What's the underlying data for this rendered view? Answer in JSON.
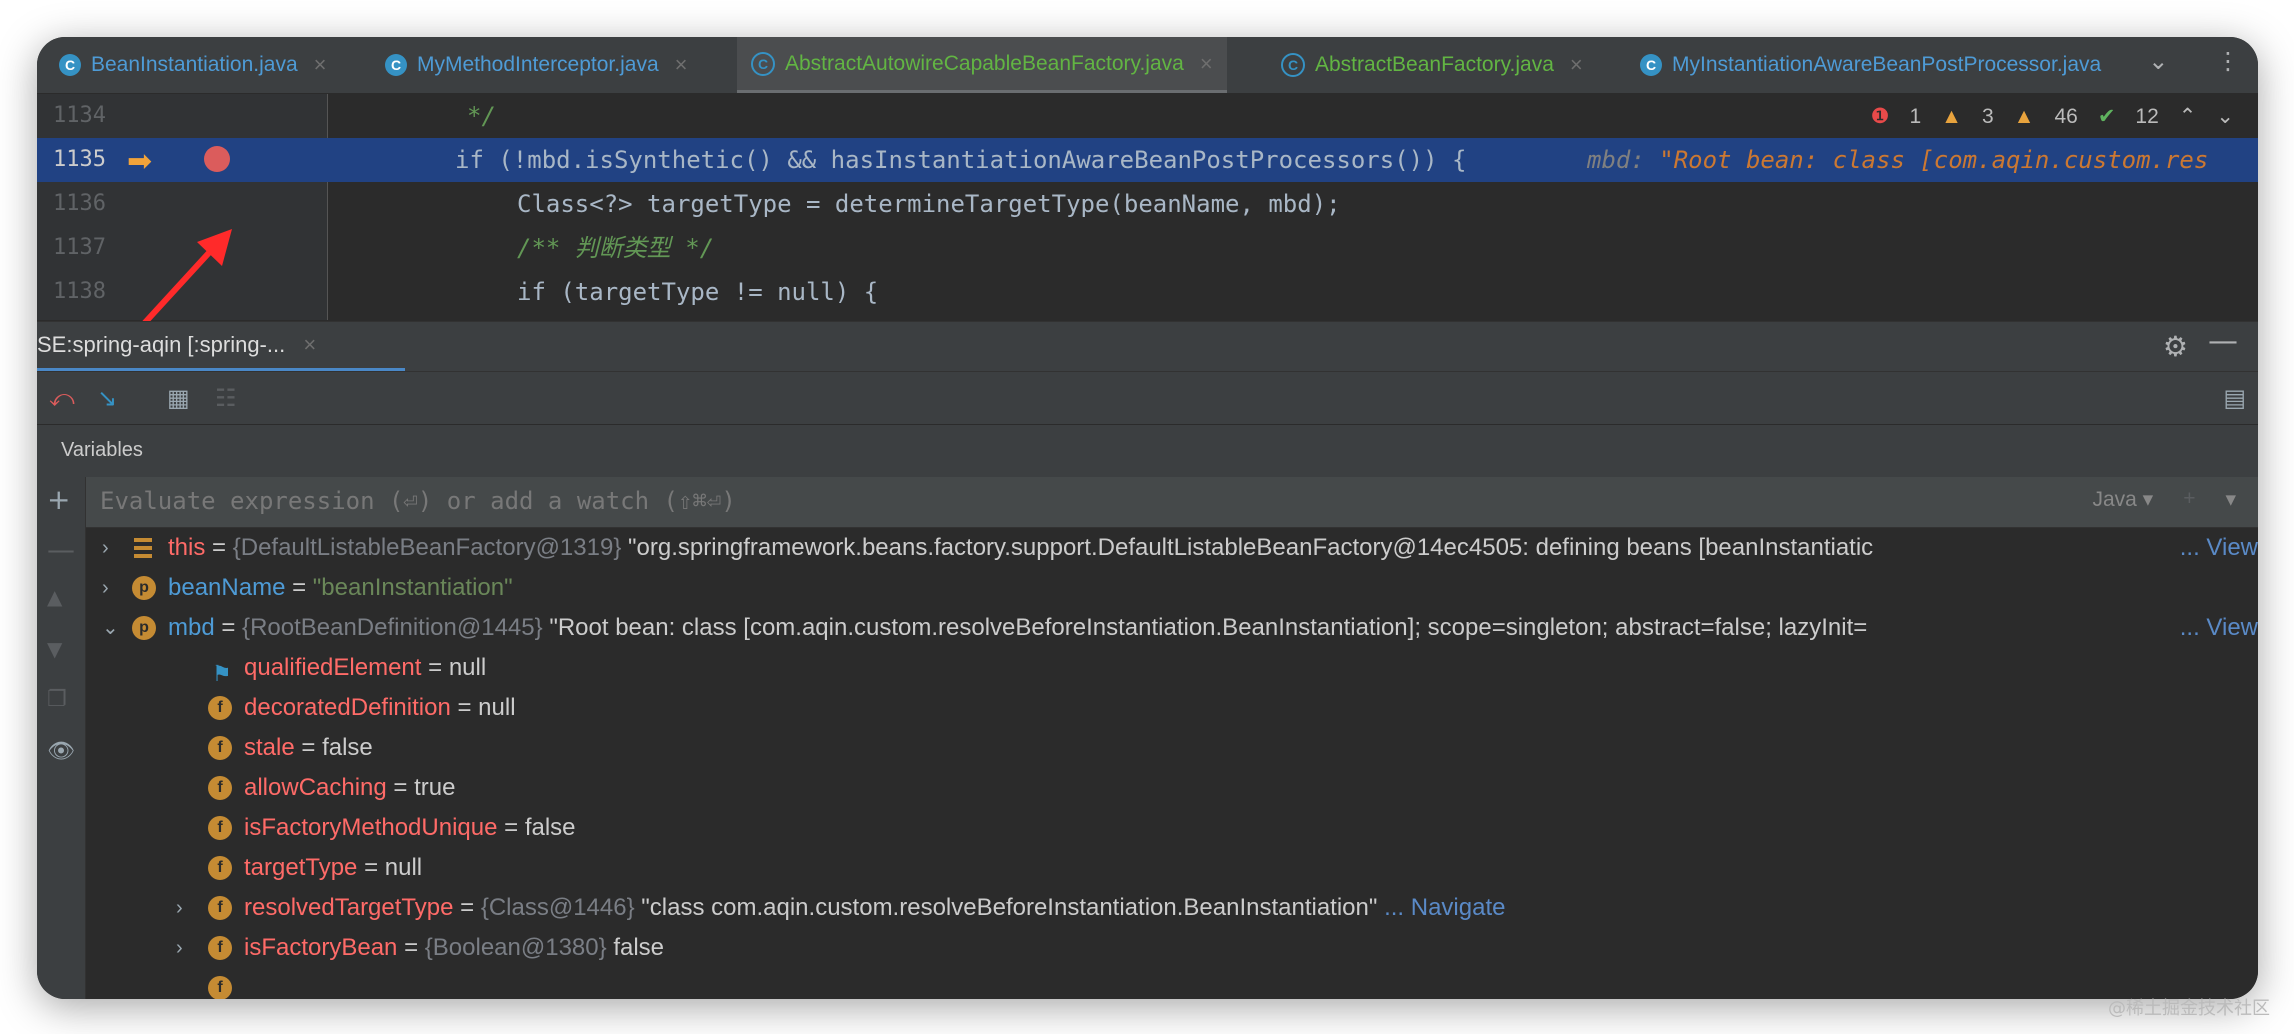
{
  "tabs": [
    {
      "label": "BeanInstantiation.java",
      "icon": "class-icon"
    },
    {
      "label": "MyMethodInterceptor.java",
      "icon": "class-icon"
    },
    {
      "label": "AbstractAutowireCapableBeanFactory.java",
      "icon": "abstract-class-icon"
    },
    {
      "label": "AbstractBeanFactory.java",
      "icon": "abstract-class-icon"
    },
    {
      "label": "MyInstantiationAwareBeanPostProcessor.java",
      "icon": "class-icon"
    }
  ],
  "editor": {
    "lines": [
      {
        "num": "1134",
        "code": "*/"
      },
      {
        "num": "1135",
        "code": "if (!mbd.isSynthetic() && hasInstantiationAwareBeanPostProcessors()) {",
        "inlay_name": "mbd:",
        "inlay_value": "\"Root bean: class [com.aqin.custom.res"
      },
      {
        "num": "1136",
        "code": "Class<?> targetType = determineTargetType(beanName, mbd);"
      },
      {
        "num": "1137",
        "code": "/** 判断类型 */"
      },
      {
        "num": "1138",
        "code": "if (targetType != null) {"
      }
    ],
    "inspections": {
      "errors": "1",
      "warnings": "3",
      "weak_warnings": "46",
      "ok": "12"
    }
  },
  "debugger": {
    "session_tab": "SE:spring-aqin [:spring-...",
    "variables_title": "Variables",
    "eval_placeholder": "Evaluate expression (⏎) or add a watch (⇧⌘⏎)",
    "language": "Java"
  },
  "variables": [
    {
      "name": "this",
      "type": "{DefaultListableBeanFactory@1319}",
      "value": "\"org.springframework.beans.factory.support.DefaultListableBeanFactory@14ec4505: defining beans [beanInstantiatic",
      "link": "... View"
    },
    {
      "name": "beanName",
      "value": "\"beanInstantiation\""
    },
    {
      "name": "mbd",
      "type": "{RootBeanDefinition@1445}",
      "value": "\"Root bean: class [com.aqin.custom.resolveBeforeInstantiation.BeanInstantiation]; scope=singleton; abstract=false; lazyInit=",
      "link": "... View"
    },
    {
      "name": "qualifiedElement",
      "value": "null"
    },
    {
      "name": "decoratedDefinition",
      "value": "null"
    },
    {
      "name": "stale",
      "value": "false"
    },
    {
      "name": "allowCaching",
      "value": "true"
    },
    {
      "name": "isFactoryMethodUnique",
      "value": "false"
    },
    {
      "name": "targetType",
      "value": "null"
    },
    {
      "name": "resolvedTargetType",
      "type": "{Class@1446}",
      "value": "\"class com.aqin.custom.resolveBeforeInstantiation.BeanInstantiation\"",
      "link": "... Navigate"
    },
    {
      "name": "isFactoryBean",
      "type": "{Boolean@1380}",
      "value": "false"
    }
  ],
  "watermark": "@稀土掘金技术社区"
}
